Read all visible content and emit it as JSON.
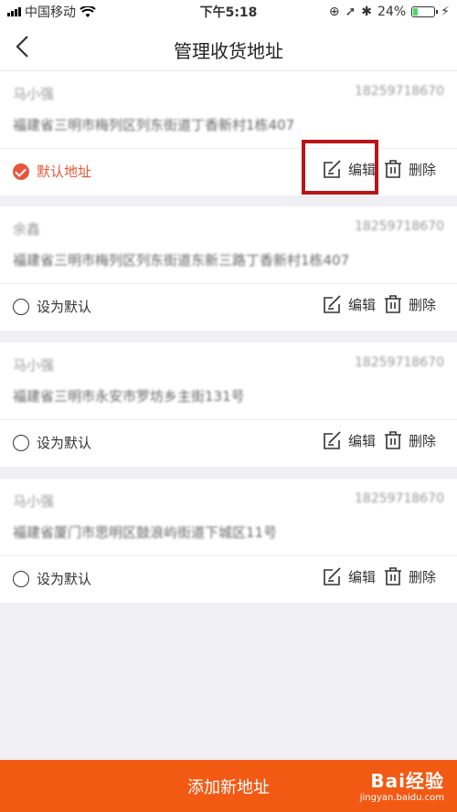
{
  "status_bar": {
    "carrier": "中国移动",
    "time": "下午5:18",
    "battery": "24%",
    "battery_level": 0.24
  },
  "nav": {
    "title": "管理收货地址"
  },
  "addresses": [
    {
      "name": "马小强",
      "phone": "18259718670",
      "address": "福建省三明市梅列区列东街道丁香新村1栋407",
      "default_label": "默认地址",
      "is_default": true,
      "edit_label": "编辑",
      "delete_label": "删除"
    },
    {
      "name": "余鑫",
      "phone": "18259718670",
      "address": "福建省三明市梅列区列东街道东新三路丁香新村1栋407",
      "default_label": "设为默认",
      "is_default": false,
      "edit_label": "编辑",
      "delete_label": "删除"
    },
    {
      "name": "马小强",
      "phone": "18259718670",
      "address": "福建省三明市永安市罗坊乡主街131号",
      "default_label": "设为默认",
      "is_default": false,
      "edit_label": "编辑",
      "delete_label": "删除"
    },
    {
      "name": "马小强",
      "phone": "18259718670",
      "address": "福建省厦门市思明区鼓浪屿街道下城区11号",
      "default_label": "设为默认",
      "is_default": false,
      "edit_label": "编辑",
      "delete_label": "删除"
    }
  ],
  "add_button": {
    "label": "添加新地址"
  },
  "watermark": {
    "logo": "Bai经验",
    "url": "jingyan.baidu.com"
  },
  "colors": {
    "accent": "#f25a14",
    "default_check": "#e8553c",
    "highlight": "#b8141a"
  }
}
